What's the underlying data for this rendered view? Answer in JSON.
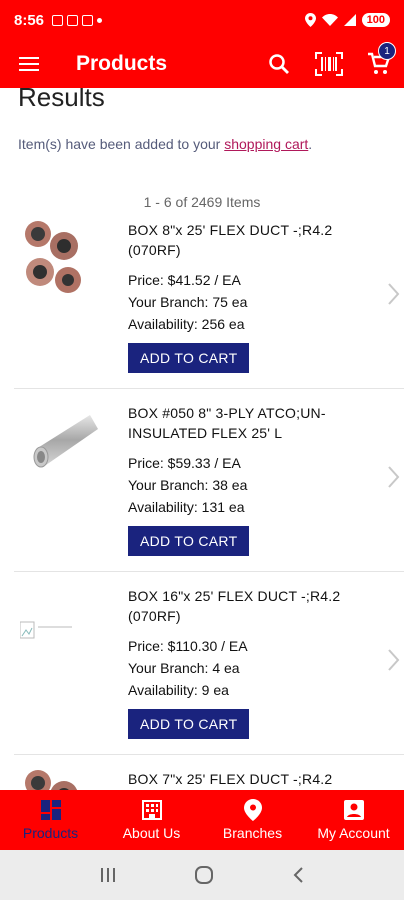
{
  "status": {
    "time": "8:56",
    "battery": "100"
  },
  "appbar": {
    "title": "Products"
  },
  "cart": {
    "badge": "1"
  },
  "page": {
    "heading": "Results",
    "cart_message_prefix": "Item(s) have been added to your ",
    "cart_link": "shopping cart",
    "cart_message_suffix": ".",
    "count": "1 - 6 of 2469 Items"
  },
  "items": [
    {
      "name": "BOX 8\"x 25' FLEX DUCT -;R4.2 (070RF)",
      "price": "Price: $41.52 / EA",
      "branch": "Your Branch: 75 ea",
      "availability": "Availability: 256 ea",
      "button": "ADD TO CART"
    },
    {
      "name": "BOX #050 8\" 3-PLY ATCO;UN-INSULATED FLEX 25' L",
      "price": "Price: $59.33 / EA",
      "branch": "Your Branch: 38 ea",
      "availability": "Availability: 131 ea",
      "button": "ADD TO CART"
    },
    {
      "name": "BOX 16\"x 25' FLEX DUCT -;R4.2 (070RF)",
      "price": "Price: $110.30 / EA",
      "branch": "Your Branch: 4 ea",
      "availability": "Availability: 9 ea",
      "button": "ADD TO CART"
    },
    {
      "name": "BOX 7\"x 25' FLEX DUCT -;R4.2"
    }
  ],
  "bottom_nav": [
    {
      "label": "Products"
    },
    {
      "label": "About Us"
    },
    {
      "label": "Branches"
    },
    {
      "label": "My Account"
    }
  ],
  "colors": {
    "brand_red": "#ff0000",
    "navy": "#1a237e"
  }
}
